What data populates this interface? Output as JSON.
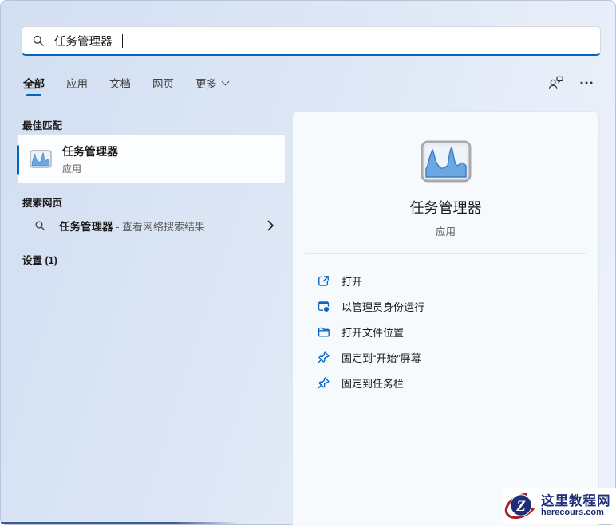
{
  "search": {
    "value": "任务管理器",
    "icon": "search-icon"
  },
  "tabs": {
    "all": "全部",
    "apps": "应用",
    "documents": "文档",
    "web": "网页",
    "more": "更多"
  },
  "topbar": {
    "user_icon": "person-chat-icon",
    "more_icon": "ellipsis-icon"
  },
  "left": {
    "best_match_heading": "最佳匹配",
    "best_match": {
      "title": "任务管理器",
      "subtitle": "应用",
      "icon": "task-manager-icon"
    },
    "web_heading": "搜索网页",
    "web_result": {
      "query": "任务管理器",
      "suffix": " - 查看网络搜索结果",
      "icon": "search-icon",
      "chevron": "chevron-right-icon"
    },
    "settings_heading": "设置 (1)"
  },
  "right": {
    "app_title": "任务管理器",
    "app_subtitle": "应用",
    "app_icon": "task-manager-icon",
    "actions": [
      {
        "label": "打开",
        "icon": "open-external-icon"
      },
      {
        "label": "以管理员身份运行",
        "icon": "run-as-admin-icon"
      },
      {
        "label": "打开文件位置",
        "icon": "folder-icon"
      },
      {
        "label": "固定到“开始”屏幕",
        "icon": "pin-icon"
      },
      {
        "label": "固定到任务栏",
        "icon": "pin-icon"
      }
    ]
  },
  "watermark": {
    "name": "这里教程网",
    "domain": "herecours.com",
    "monogram": "Z"
  },
  "colors": {
    "accent": "#0067c0",
    "action_icon_blue": "#0b66c3",
    "watermark_navy": "#22307c",
    "watermark_red": "#a2242a",
    "taskbar_strip": "#40598f"
  }
}
